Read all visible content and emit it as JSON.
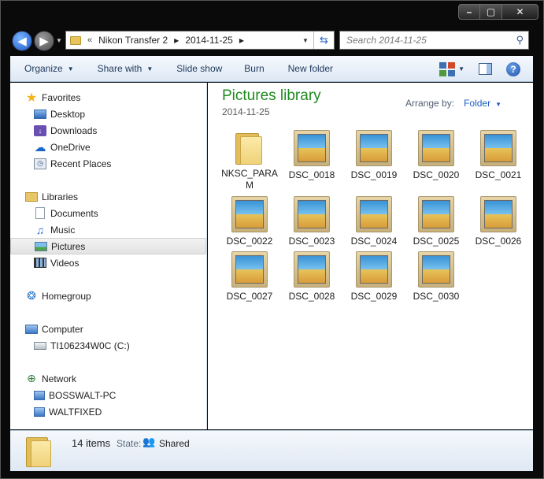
{
  "address": {
    "crumbs": [
      "Nikon Transfer 2",
      "2014-11-25"
    ]
  },
  "search": {
    "placeholder": "Search 2014-11-25"
  },
  "toolbar": {
    "organize": "Organize",
    "share_with": "Share with",
    "slide_show": "Slide show",
    "burn": "Burn",
    "new_folder": "New folder"
  },
  "nav": {
    "favorites": "Favorites",
    "desktop": "Desktop",
    "downloads": "Downloads",
    "onedrive": "OneDrive",
    "recent_places": "Recent Places",
    "libraries": "Libraries",
    "documents": "Documents",
    "music": "Music",
    "pictures": "Pictures",
    "videos": "Videos",
    "homegroup": "Homegroup",
    "computer": "Computer",
    "drive": "TI106234W0C (C:)",
    "network": "Network",
    "pc1": "BOSSWALT-PC",
    "pc2": "WALTFIXED"
  },
  "content": {
    "title": "Pictures library",
    "subtitle": "2014-11-25",
    "arrange_label": "Arrange by:",
    "arrange_value": "Folder",
    "items": [
      {
        "name": "NKSC_PARAM",
        "kind": "folder"
      },
      {
        "name": "DSC_0018",
        "kind": "image"
      },
      {
        "name": "DSC_0019",
        "kind": "image"
      },
      {
        "name": "DSC_0020",
        "kind": "image"
      },
      {
        "name": "DSC_0021",
        "kind": "image"
      },
      {
        "name": "DSC_0022",
        "kind": "image"
      },
      {
        "name": "DSC_0023",
        "kind": "image"
      },
      {
        "name": "DSC_0024",
        "kind": "image"
      },
      {
        "name": "DSC_0025",
        "kind": "image"
      },
      {
        "name": "DSC_0026",
        "kind": "image"
      },
      {
        "name": "DSC_0027",
        "kind": "image"
      },
      {
        "name": "DSC_0028",
        "kind": "image"
      },
      {
        "name": "DSC_0029",
        "kind": "image"
      },
      {
        "name": "DSC_0030",
        "kind": "image"
      }
    ]
  },
  "details": {
    "count": "14 items",
    "state_label": "State:",
    "state_value": "Shared"
  }
}
